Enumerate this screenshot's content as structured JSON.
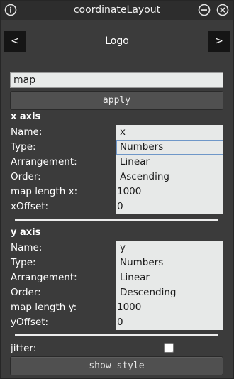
{
  "window": {
    "title": "coordinateLayout"
  },
  "icons": {
    "info": "info-icon",
    "minimize": "minimize-icon",
    "close": "close-icon"
  },
  "nav": {
    "prev_label": "<",
    "next_label": ">",
    "logo_text": "Logo"
  },
  "map_input": {
    "value": "map"
  },
  "apply_label": "apply",
  "x_axis": {
    "heading": "x axis",
    "labels": {
      "name": "Name:",
      "type": "Type:",
      "arrangement": "Arrangement:",
      "order": "Order:",
      "length": "map length x:",
      "offset": "xOffset:"
    },
    "values": {
      "name": "x",
      "type": "Numbers",
      "arrangement": "Linear",
      "order": "Ascending",
      "length": "1000",
      "offset": "0"
    }
  },
  "y_axis": {
    "heading": "y axis",
    "labels": {
      "name": "Name:",
      "type": "Type:",
      "arrangement": "Arrangement:",
      "order": "Order:",
      "length": "map length y:",
      "offset": "yOffset:"
    },
    "values": {
      "name": "y",
      "type": "Numbers",
      "arrangement": "Linear",
      "order": "Descending",
      "length": "1000",
      "offset": "0"
    }
  },
  "jitter": {
    "label": "jitter:",
    "checked": false
  },
  "show_style_label": "show style",
  "colors": {
    "window_bg": "#3b3b3b",
    "titlebar_bg": "#2d2d2d",
    "field_bg": "#e7e9e8",
    "focus_border": "#6f97c8"
  }
}
